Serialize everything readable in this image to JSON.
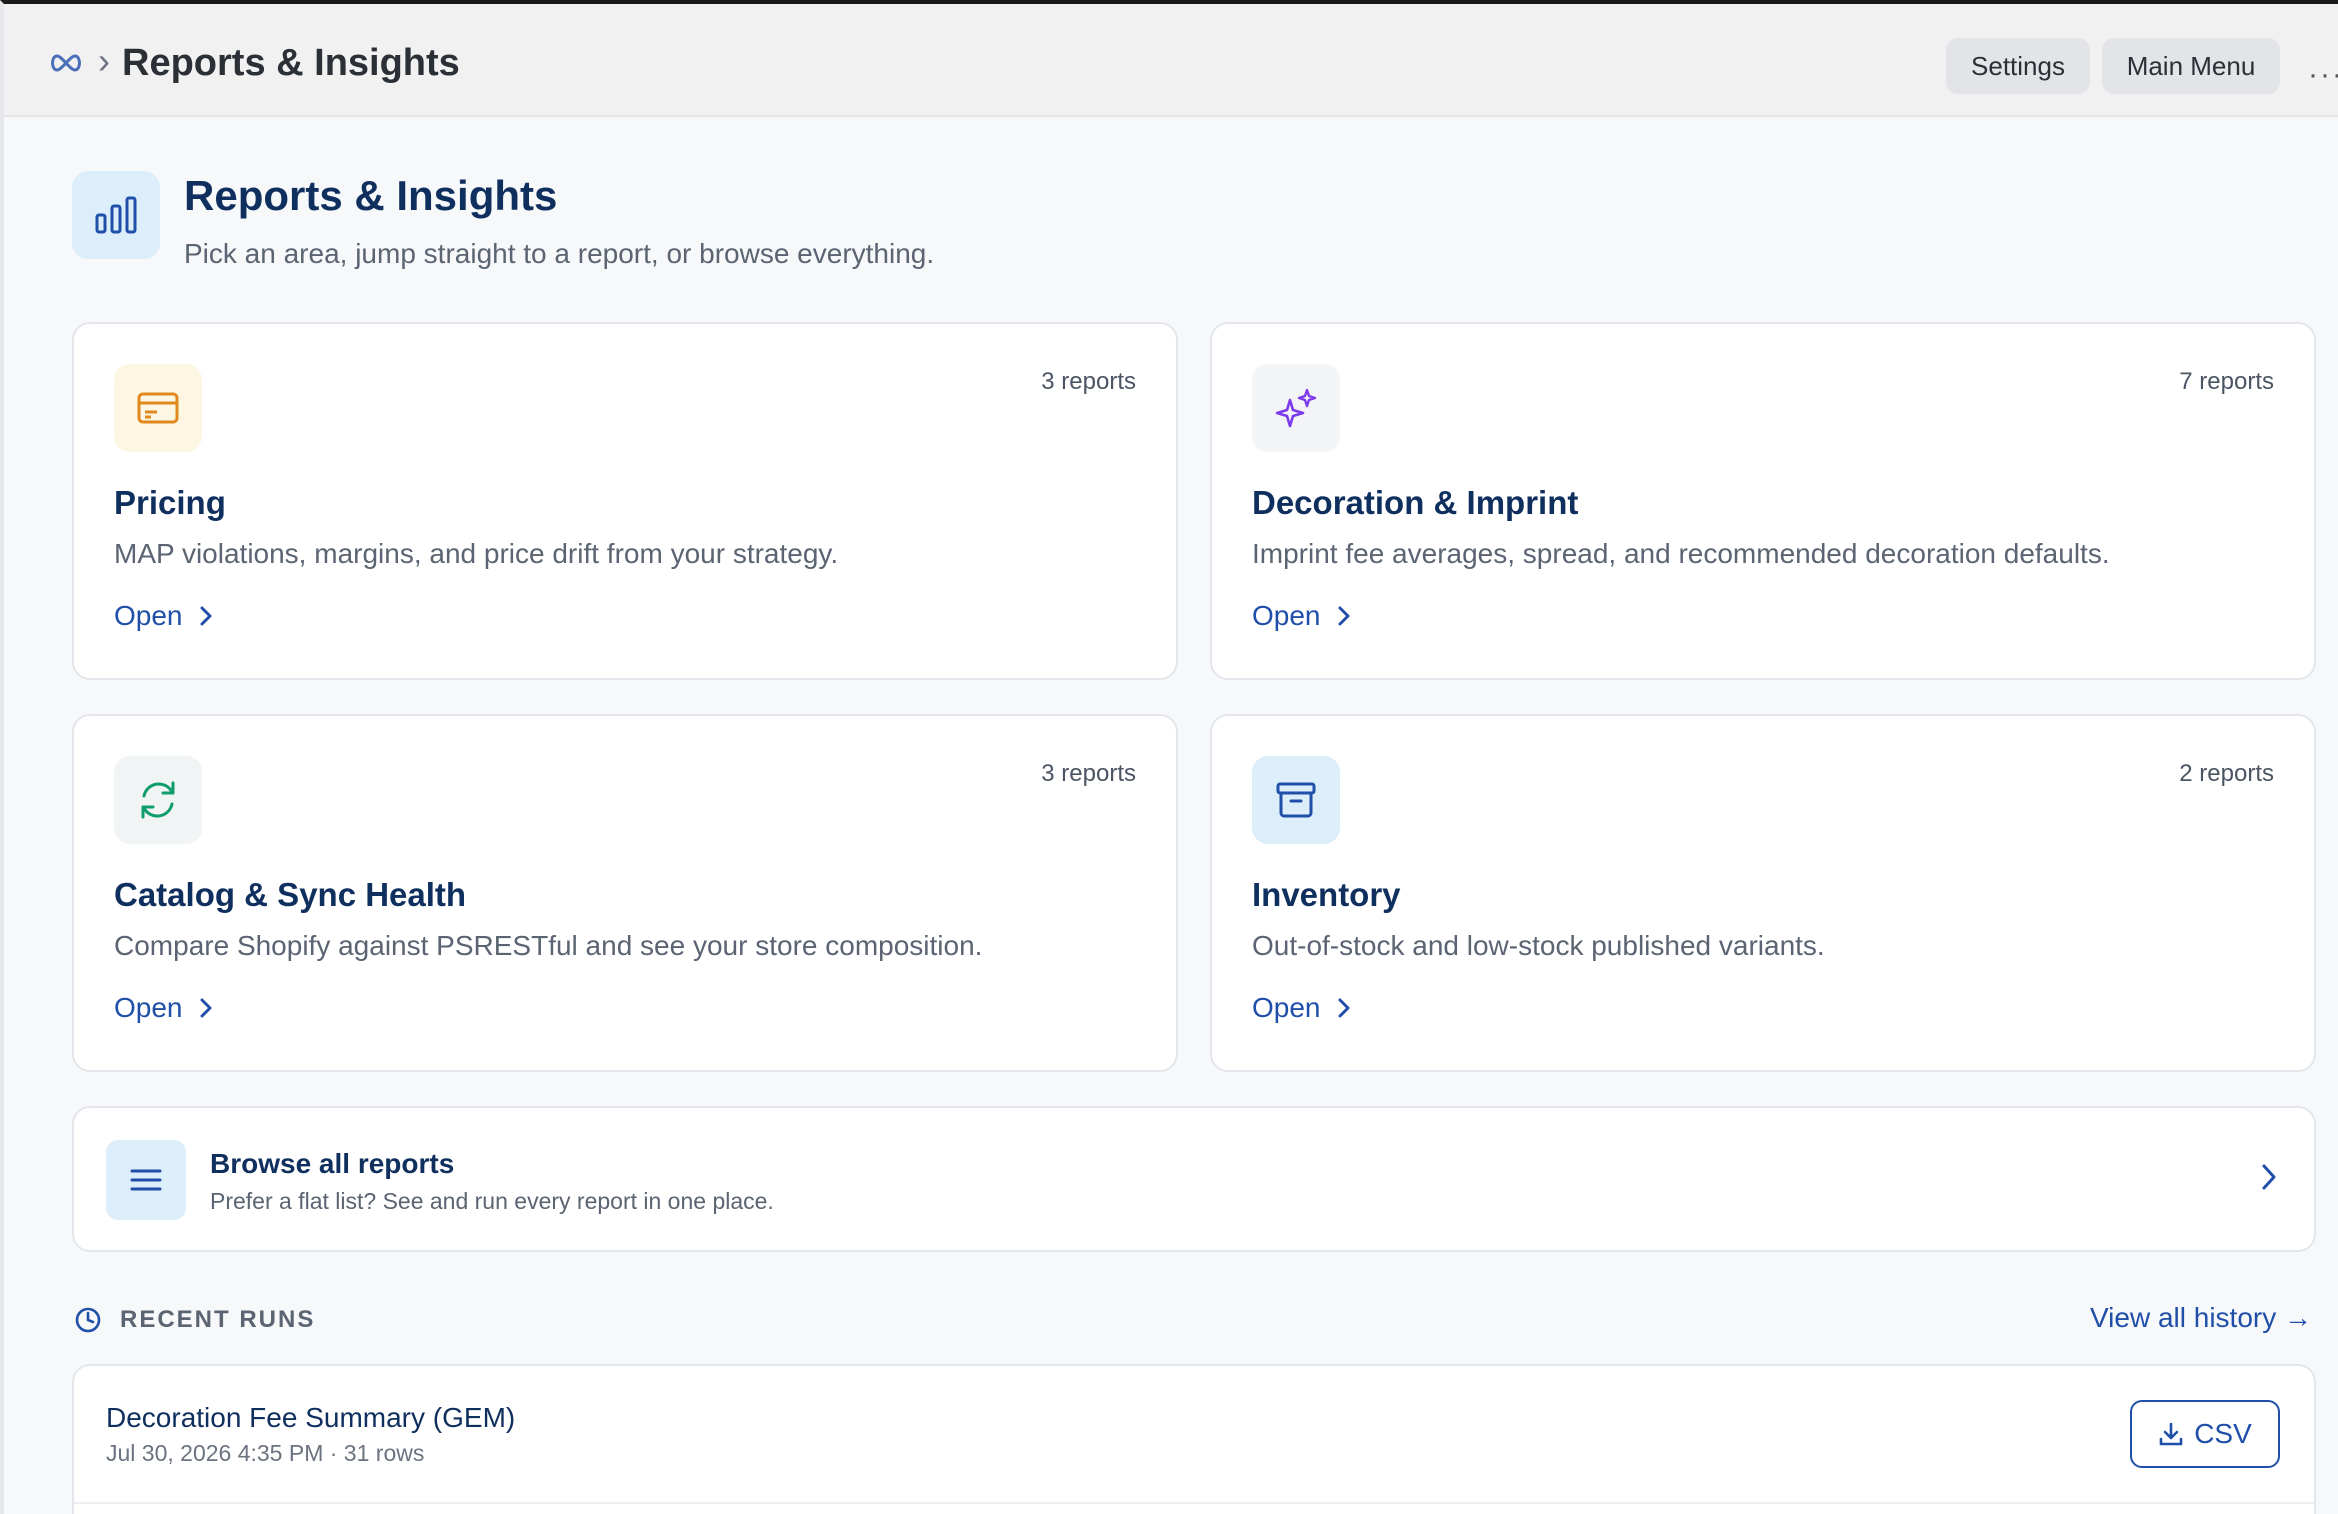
{
  "topbar": {
    "breadcrumb_title": "Reports & Insights",
    "settings_label": "Settings",
    "main_menu_label": "Main Menu",
    "more_label": "···",
    "logo_icon": "infinity-icon"
  },
  "header": {
    "title": "Reports & Insights",
    "subtitle": "Pick an area, jump straight to a report, or browse everything.",
    "icon": "bar-chart-icon"
  },
  "cards": [
    {
      "title": "Pricing",
      "count": "3 reports",
      "desc": "MAP violations, margins, and price drift from your strategy.",
      "open": "Open",
      "icon": "credit-card-icon",
      "icon_bg": "#fdf6e3",
      "icon_color": "#e08a1e"
    },
    {
      "title": "Decoration & Imprint",
      "count": "7 reports",
      "desc": "Imprint fee averages, spread, and recommended decoration defaults.",
      "open": "Open",
      "icon": "sparkles-icon",
      "icon_bg": "#f3f4f6",
      "icon_color": "#7c3aed"
    },
    {
      "title": "Catalog & Sync Health",
      "count": "3 reports",
      "desc": "Compare Shopify against PSRESTful and see your store composition.",
      "open": "Open",
      "icon": "refresh-icon",
      "icon_bg": "#f1f4f4",
      "icon_color": "#0f9d6b"
    },
    {
      "title": "Inventory",
      "count": "2 reports",
      "desc": "Out-of-stock and low-stock published variants.",
      "open": "Open",
      "icon": "archive-box-icon",
      "icon_bg": "#ddeefb",
      "icon_color": "#1f4fa8"
    }
  ],
  "browse": {
    "title": "Browse all reports",
    "subtitle": "Prefer a flat list? See and run every report in one place."
  },
  "recent": {
    "label": "RECENT RUNS",
    "view_all": "View all history →",
    "runs": [
      {
        "title": "Decoration Fee Summary (GEM)",
        "meta": "Jul 30, 2026 4:35 PM · 31 rows",
        "csv_label": "CSV"
      }
    ]
  },
  "colors": {
    "accent": "#1f4fa8",
    "title": "#0f2f5e"
  }
}
